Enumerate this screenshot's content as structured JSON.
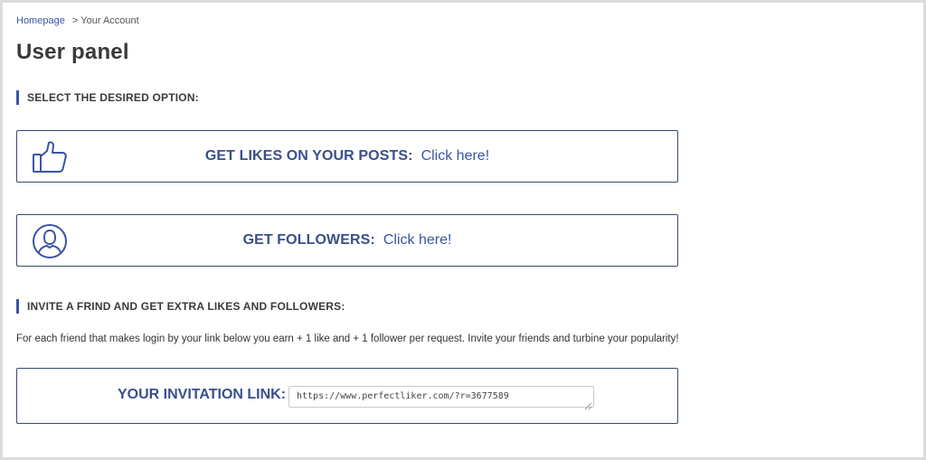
{
  "breadcrumb": {
    "home": "Homepage",
    "separator": ">",
    "current": "Your Account"
  },
  "page_title": "User panel",
  "sections": {
    "options_heading": "SELECT THE DESIRED OPTION:",
    "invite_heading": "INVITE A FRIND AND GET EXTRA LIKES AND FOLLOWERS:"
  },
  "options": [
    {
      "icon": "thumbs-up-icon",
      "label": "GET LIKES ON YOUR POSTS:",
      "link": "Click here!"
    },
    {
      "icon": "user-icon",
      "label": "GET FOLLOWERS:",
      "link": "Click here!"
    }
  ],
  "invite": {
    "description": "For each friend that makes login by your link below you earn + 1 like and + 1 follower per request. Invite your friends and turbine your popularity!",
    "label": "YOUR INVITATION LINK:",
    "link_value": "https://www.perfectliker.com/?r=3677589"
  },
  "colors": {
    "accent": "#3a55a4",
    "heading": "#3a4f8c",
    "border": "#3a4a6b",
    "background": "#dcdcdc"
  }
}
